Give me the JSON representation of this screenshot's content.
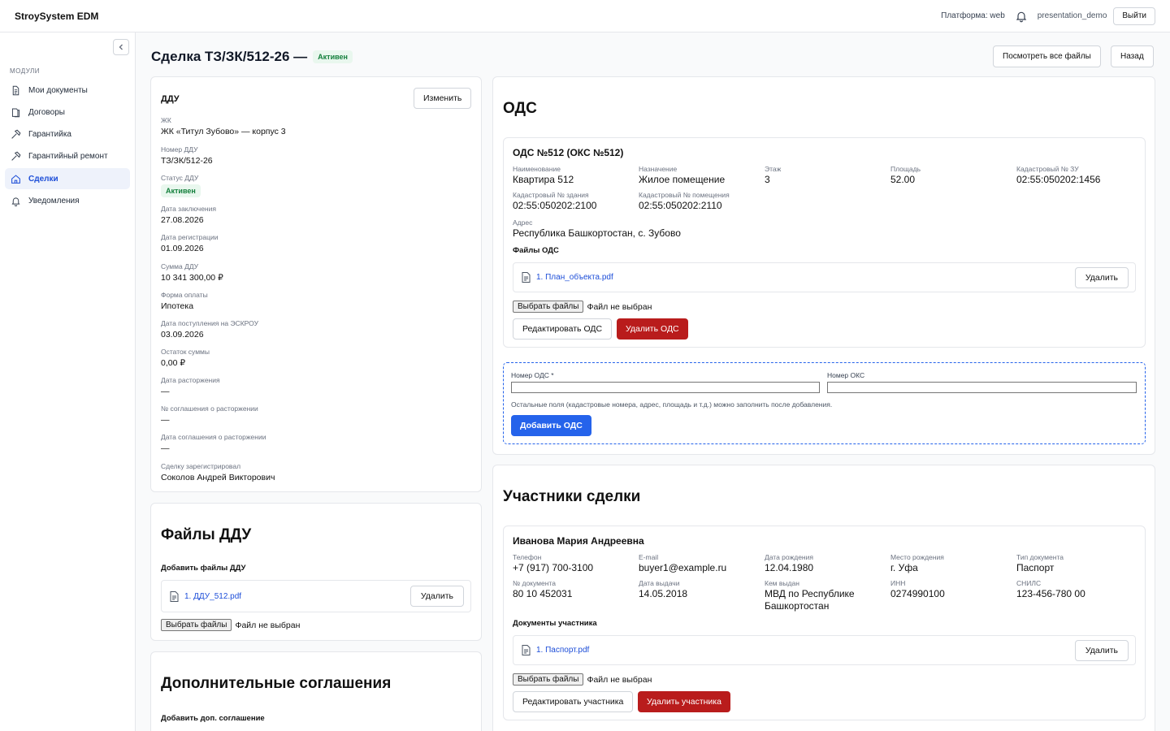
{
  "app": {
    "title": "StroySystem EDM",
    "platform": "Платформа: web",
    "user": "presentation_demo",
    "logout": "Выйти"
  },
  "sidebar": {
    "section": "МОДУЛИ",
    "items": [
      {
        "label": "Мои документы",
        "icon": "document-icon"
      },
      {
        "label": "Договоры",
        "icon": "documents-icon"
      },
      {
        "label": "Гарантийка",
        "icon": "hammer-icon"
      },
      {
        "label": "Гарантийный ремонт",
        "icon": "hammer-icon"
      },
      {
        "label": "Сделки",
        "icon": "home-icon",
        "active": true
      },
      {
        "label": "Уведомления",
        "icon": "bell-icon"
      }
    ]
  },
  "page": {
    "title": "Сделка ТЗ/ЗК/512-26 —",
    "status": "Активен",
    "view_all_files": "Посмотреть все файлы",
    "back": "Назад"
  },
  "ddu": {
    "title": "ДДУ",
    "edit": "Изменить",
    "fields": [
      {
        "label": "ЖК",
        "value": "ЖК «Титул Зубово» — корпус 3"
      },
      {
        "label": "Номер ДДУ",
        "value": "ТЗ/ЗК/512-26"
      },
      {
        "label": "Статус ДДУ",
        "value": "Активен"
      },
      {
        "label": "Дата заключения",
        "value": "27.08.2026"
      },
      {
        "label": "Дата регистрации",
        "value": "01.09.2026"
      },
      {
        "label": "Сумма ДДУ",
        "value": "10 341 300,00 ₽"
      },
      {
        "label": "Форма оплаты",
        "value": "Ипотека"
      },
      {
        "label": "Дата поступления на ЭСКРОУ",
        "value": "03.09.2026"
      },
      {
        "label": "Остаток суммы",
        "value": "0,00 ₽"
      },
      {
        "label": "Дата расторжения",
        "value": "—"
      },
      {
        "label": "№ соглашения о расторжении",
        "value": "—"
      },
      {
        "label": "Дата соглашения о расторжении",
        "value": "—"
      },
      {
        "label": "Сделку зарегистрировал",
        "value": "Соколов Андрей Викторович"
      }
    ]
  },
  "ddu_files": {
    "title": "Файлы ДДУ",
    "add_label": "Добавить файлы ДДУ",
    "file": "1. ДДУ_512.pdf",
    "delete": "Удалить",
    "choose": "Выбрать файлы",
    "no_file": "Файл не выбран"
  },
  "addendum": {
    "title": "Дополнительные соглашения",
    "add_label": "Добавить доп. соглашение"
  },
  "ods": {
    "title": "ОДС",
    "item": {
      "title": "ОДС №512 (ОКС №512)",
      "cells": [
        {
          "label": "Наименование",
          "value": "Квартира 512"
        },
        {
          "label": "Назначение",
          "value": "Жилое помещение"
        },
        {
          "label": "Этаж",
          "value": "3"
        },
        {
          "label": "Площадь",
          "value": "52.00"
        },
        {
          "label": "Кадастровый № ЗУ",
          "value": "02:55:050202:1456"
        },
        {
          "label": "Кадастровый № здания",
          "value": "02:55:050202:2100"
        },
        {
          "label": "Кадастровый № помещения",
          "value": "02:55:050202:2110"
        },
        {
          "label": "Адрес",
          "value": "Республика Башкортостан, с. Зубово"
        }
      ],
      "files_label": "Файлы ОДС",
      "file": "1. План_объекта.pdf",
      "delete": "Удалить",
      "choose": "Выбрать файлы",
      "no_file": "Файл не выбран",
      "edit": "Редактировать ОДС",
      "remove": "Удалить ОДС"
    },
    "form": {
      "ods_label": "Номер ОДС *",
      "oks_label": "Номер ОКС",
      "hint": "Остальные поля (кадастровые номера, адрес, площадь и т.д.) можно заполнить после добавления.",
      "add": "Добавить ОДС"
    }
  },
  "participants": {
    "title": "Участники сделки",
    "person": {
      "name": "Иванова Мария Андреевна",
      "cells": [
        {
          "label": "Телефон",
          "value": "+7 (917) 700-3100"
        },
        {
          "label": "E-mail",
          "value": "buyer1@example.ru"
        },
        {
          "label": "Дата рождения",
          "value": "12.04.1980"
        },
        {
          "label": "Место рождения",
          "value": "г. Уфа"
        },
        {
          "label": "Тип документа",
          "value": "Паспорт"
        },
        {
          "label": "№ документа",
          "value": "80 10 452031"
        },
        {
          "label": "Дата выдачи",
          "value": "14.05.2018"
        },
        {
          "label": "Кем выдан",
          "value": "МВД по Республике Башкортостан"
        },
        {
          "label": "ИНН",
          "value": "0274990100"
        },
        {
          "label": "СНИЛС",
          "value": "123-456-780 00"
        }
      ],
      "docs_label": "Документы участника",
      "file": "1. Паспорт.pdf",
      "delete": "Удалить",
      "choose": "Выбрать файлы",
      "no_file": "Файл не выбран",
      "edit": "Редактировать участника",
      "remove": "Удалить участника"
    }
  }
}
